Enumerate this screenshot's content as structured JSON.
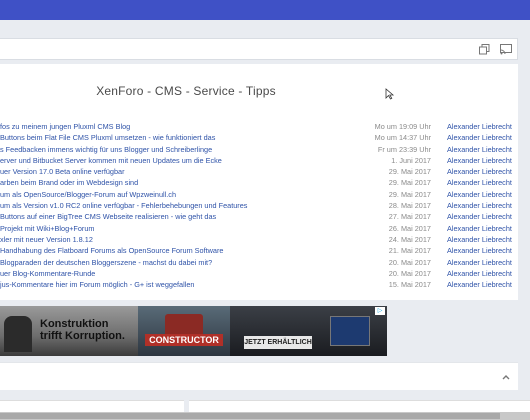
{
  "colors": {
    "accent": "#3f51c6",
    "link": "#2f53a8",
    "meta": "#8a8a8a"
  },
  "toolbar": {
    "icons": [
      "copy-icon",
      "cast-icon"
    ]
  },
  "header": {
    "site_title": "XenForo - CMS - Service - Tipps"
  },
  "threads": [
    {
      "title": "fos zu meinem jungen Pluxml CMS Blog",
      "date": "Mo um 19:09 Uhr",
      "author": "Alexander Liebrecht"
    },
    {
      "title": "Buttons beim Flat File CMS Pluxml umsetzen - wie funktioniert das",
      "date": "Mo um 14:37 Uhr",
      "author": "Alexander Liebrecht"
    },
    {
      "title": "s Feedbacken immens wichtig für uns Blogger und Schreiberlinge",
      "date": "Fr um 23:39 Uhr",
      "author": "Alexander Liebrecht"
    },
    {
      "title": "erver und Bitbucket Server kommen mit neuen Updates um die Ecke",
      "date": "1. Juni 2017",
      "author": "Alexander Liebrecht"
    },
    {
      "title": "uer Version 17.0 Beta online verfügbar",
      "date": "29. Mai 2017",
      "author": "Alexander Liebrecht"
    },
    {
      "title": "arben beim Brand oder im Webdesign sind",
      "date": "29. Mai 2017",
      "author": "Alexander Liebrecht"
    },
    {
      "title": "um als OpenSource/Blogger-Forum auf Wpzweinull.ch",
      "date": "29. Mai 2017",
      "author": "Alexander Liebrecht"
    },
    {
      "title": "um als Version v1.0 RC2 online verfügbar - Fehlerbehebungen und Features",
      "date": "28. Mai 2017",
      "author": "Alexander Liebrecht"
    },
    {
      "title": "Buttons auf einer BigTree CMS Webseite realisieren - wie geht das",
      "date": "27. Mai 2017",
      "author": "Alexander Liebrecht"
    },
    {
      "title": "Projekt mit Wiki+Blog+Forum",
      "date": "26. Mai 2017",
      "author": "Alexander Liebrecht"
    },
    {
      "title": "xler mit neuer Version 1.8.12",
      "date": "24. Mai 2017",
      "author": "Alexander Liebrecht"
    },
    {
      "title": "Handhabung des Flatboard Forums als OpenSource Forum Software",
      "date": "21. Mai 2017",
      "author": "Alexander Liebrecht"
    },
    {
      "title": "Blogparaden der deutschen Bloggerszene - machst du dabei mit?",
      "date": "20. Mai 2017",
      "author": "Alexander Liebrecht"
    },
    {
      "title": "uer Blog-Kommentare-Runde",
      "date": "20. Mai 2017",
      "author": "Alexander Liebrecht"
    },
    {
      "title": "jus-Kommentare hier im Forum möglich - G+ ist weggefallen",
      "date": "15. Mai 2017",
      "author": "Alexander Liebrecht"
    }
  ],
  "ad": {
    "headline_1": "Konstruktion",
    "headline_2": "trifft Korruption.",
    "logo_text": "CONSTRUCTOR",
    "cta": "JETZT ERHÄLTLICH"
  }
}
